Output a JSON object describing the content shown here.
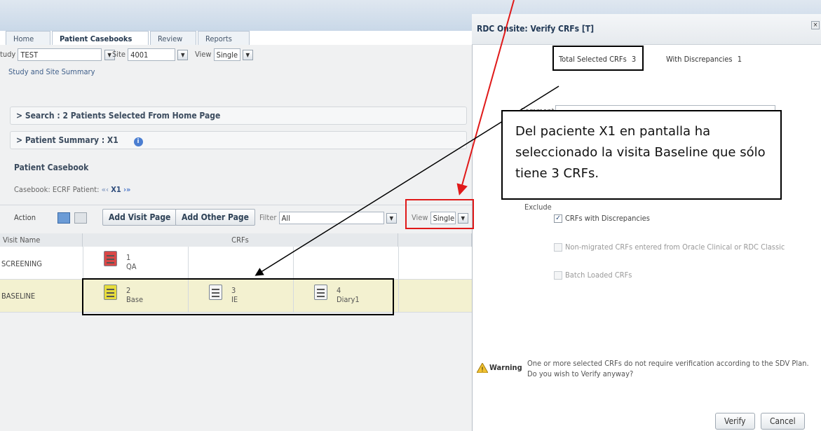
{
  "tabs": [
    "Home",
    "Patient Casebooks",
    "Review",
    "Reports"
  ],
  "filters": {
    "study_label": "tudy",
    "study_value": "TEST",
    "site_label": "Site",
    "site_value": "4001",
    "view_label": "View",
    "view_value": "Single",
    "summary_link": "Study and Site Summary"
  },
  "sections": {
    "search": "Search : 2 Patients Selected From Home Page",
    "patient_summary": "Patient Summary : X1"
  },
  "casebook": {
    "title": "Patient Casebook",
    "casebook_label": "Casebook:",
    "casebook_value": "ECRF",
    "patient_label": "Patient:",
    "patient_value": "X1"
  },
  "toolbar": {
    "action": "Action",
    "add_visit": "Add Visit Page",
    "add_other": "Add Other Page",
    "filter_label": "Filter",
    "filter_value": "All",
    "view_label": "View",
    "view_value": "Single"
  },
  "grid": {
    "col_visit": "Visit Name",
    "col_crfs": "CRFs",
    "rows": [
      {
        "visit": "SCREENING",
        "crfs": [
          {
            "num": "1",
            "name": "QA"
          }
        ]
      },
      {
        "visit": "BASELINE",
        "crfs": [
          {
            "num": "2",
            "name": "Base"
          },
          {
            "num": "3",
            "name": "IE"
          },
          {
            "num": "4",
            "name": "Diary1"
          }
        ]
      }
    ]
  },
  "dialog": {
    "title": "RDC Onsite: Verify CRFs [T]",
    "total_label": "Total Selected CRFs",
    "total_value": "3",
    "disc_label": "With Discrepancies",
    "disc_value": "1",
    "comment_label": "Comment",
    "exclude_label": "Exclude",
    "opt1": "CRFs with Discrepancies",
    "opt2": "Non-migrated CRFs entered from Oracle Clinical or RDC Classic",
    "opt3": "Batch Loaded CRFs",
    "warning_label": "Warning",
    "warning_text": "One or more selected CRFs do not require verification according to the SDV Plan. Do you wish to Verify anyway?",
    "verify": "Verify",
    "cancel": "Cancel"
  },
  "callout": "Del paciente X1 en pantalla ha seleccionado la visita Baseline que sólo tiene 3 CRFs.",
  "colors": {
    "annotation_red": "#e01919",
    "baseline_row": "#f3f1d0",
    "crf_red": "#d94747",
    "crf_yellow": "#e6dc3c"
  }
}
